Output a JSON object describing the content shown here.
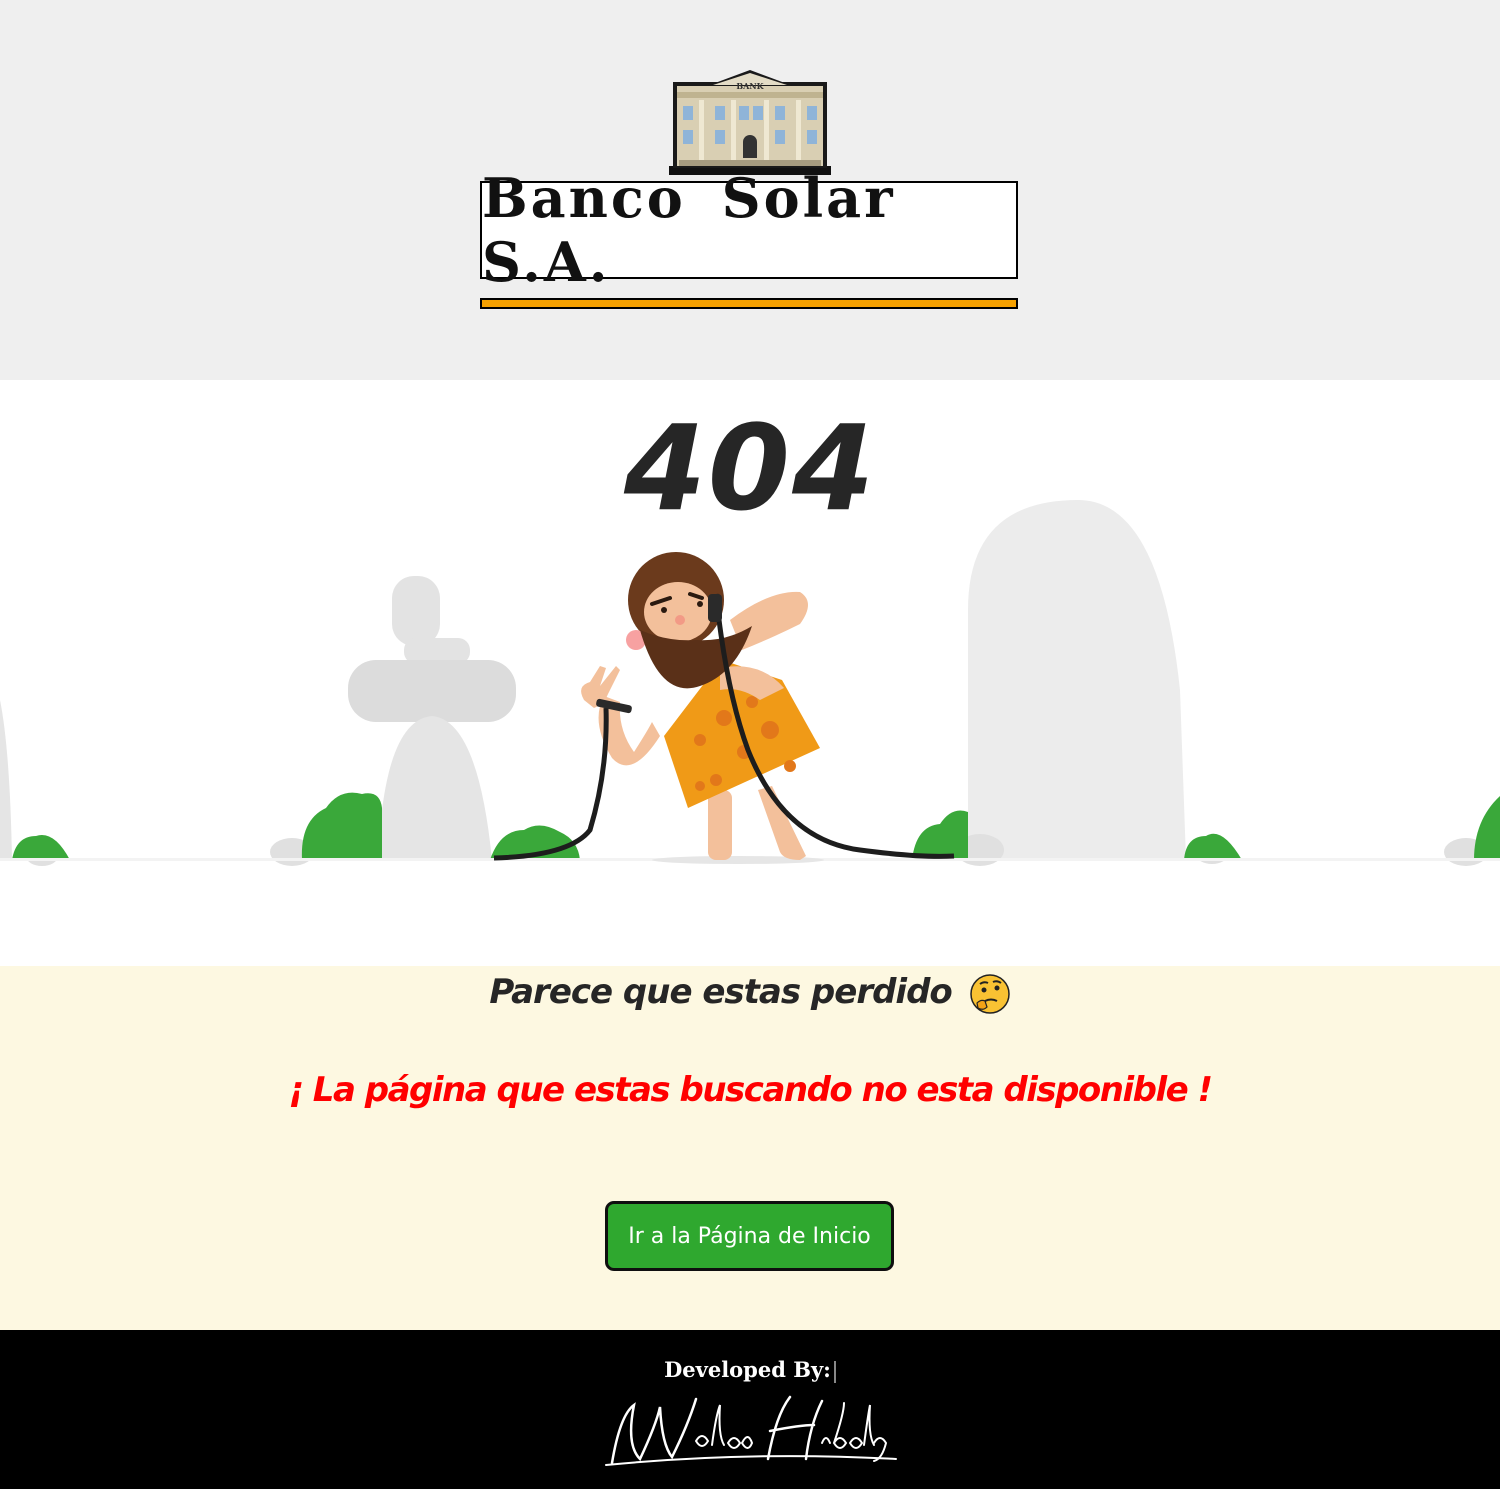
{
  "header": {
    "logo_sign": "BANK",
    "brand_name": "Banco Solar S.A."
  },
  "error": {
    "code": "404"
  },
  "message": {
    "lost": "Parece que estas perdido",
    "notice": "¡ La página que estas buscando no esta disponible !"
  },
  "actions": {
    "home_button": "Ir a la Página de Inicio"
  },
  "footer": {
    "developed_by": "Developed By:",
    "signature": "Waldo Hidalgo"
  },
  "colors": {
    "header_bg": "#efefef",
    "accent_bar": "#f5a000",
    "notice_text": "#ff0000",
    "button_bg": "#2fa82f",
    "message_bg": "#fdf8e1",
    "footer_bg": "#000000"
  }
}
